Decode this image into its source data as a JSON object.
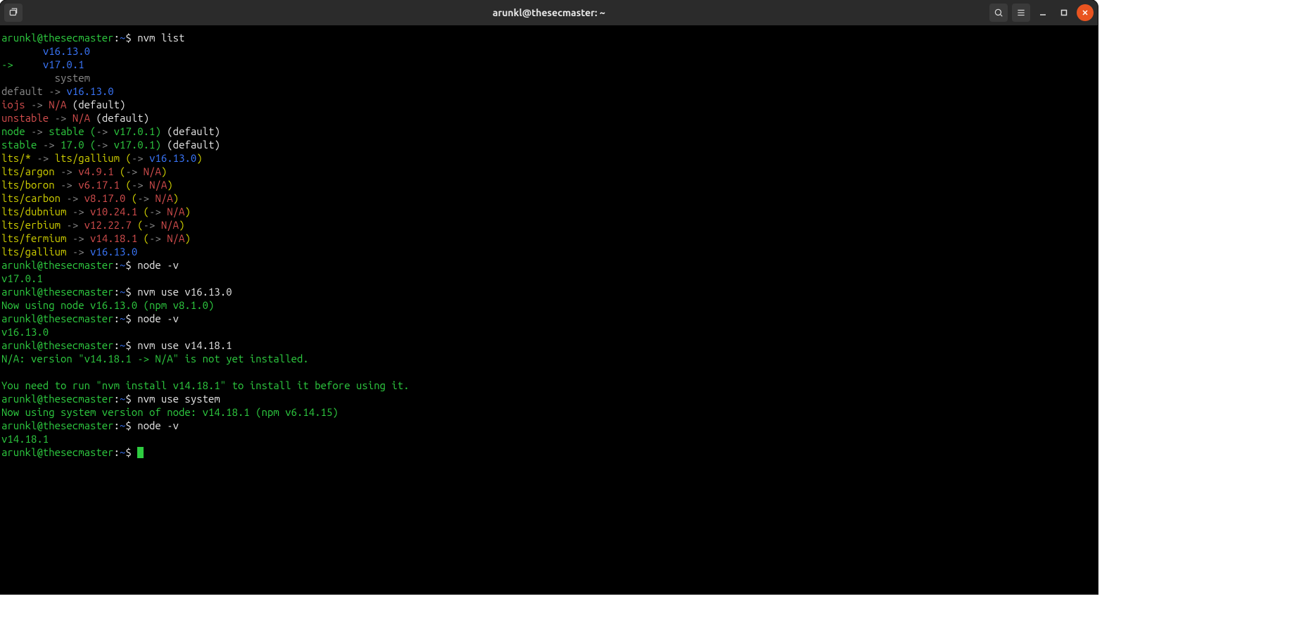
{
  "window": {
    "title": "arunkl@thesecmaster: ~"
  },
  "titlebar_icons": {
    "new_tab": "⌘",
    "search": "search-icon",
    "menu": "menu-icon",
    "minimize": "–",
    "maximize": "❐",
    "close": "✕"
  },
  "prompt": {
    "user_host": "arunkl@thesecmaster",
    "colon": ":",
    "cwd": "~",
    "dollar": "$ "
  },
  "cmds": {
    "c1": "nvm list",
    "c2": "node -v",
    "c3": "nvm use v16.13.0",
    "c4": "node -v",
    "c5": "nvm use v14.18.1",
    "c6": "nvm use system",
    "c7": "node -v"
  },
  "list": {
    "indent7": "       ",
    "arrow": "->",
    "v16": "v16.13.0",
    "v17": "v17.0.1",
    "system": "system",
    "default_lhs": "default",
    "default_rhs": "v16.13.0",
    "iojs_lhs": "iojs",
    "na": "N/A",
    "paren_default": "(default)",
    "unstable_lhs": "unstable",
    "node_lhs": "node",
    "stable_word": "stable",
    "stable_lhs": "stable",
    "ver17_0": "17.0",
    "arrow_in_paren_open": "(",
    "arrow_in_paren_close": ")",
    "arrow_sym": "-> ",
    "v17_0_1": "v17.0.1",
    "lts_star": "lts/*",
    "lts_gallium": "lts/gallium",
    "lts_argon": "lts/argon",
    "lts_boron": "lts/boron",
    "lts_carbon": "lts/carbon",
    "lts_dubnium": "lts/dubnium",
    "lts_erbium": "lts/erbium",
    "lts_fermium": "lts/fermium",
    "lts_gallium2": "lts/gallium",
    "v4_9_1": "v4.9.1",
    "v6_17_1": "v6.17.1",
    "v8_17_0": "v8.17.0",
    "v10_24_1": "v10.24.1",
    "v12_22_7": "v12.22.7",
    "v14_18_1": "v14.18.1",
    "v16_13_0b": "v16.13.0"
  },
  "out": {
    "node_v17": "v17.0.1",
    "now_using_16": "Now using node v16.13.0 (npm v8.1.0)",
    "node_v16": "v16.13.0",
    "na_line": "N/A: version \"v14.18.1 -> N/A\" is not yet installed.",
    "blank": "",
    "need_run": "You need to run \"nvm install v14.18.1\" to install it before using it.",
    "now_using_sys": "Now using system version of node: v14.18.1 (npm v6.14.15)",
    "node_v14": "v14.18.1"
  }
}
